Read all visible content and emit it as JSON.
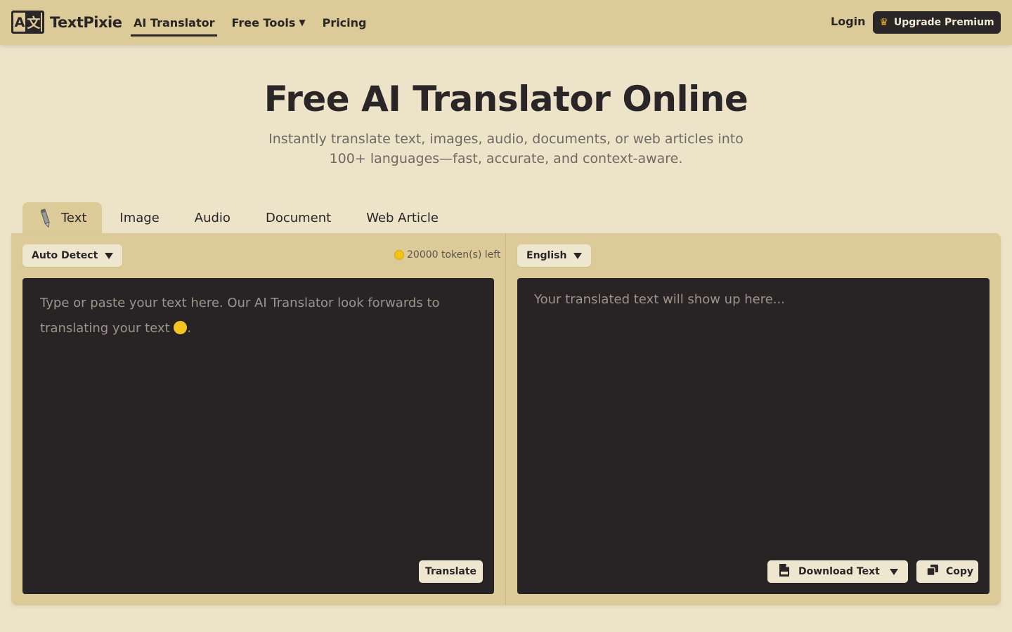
{
  "header": {
    "logo_mark": "A文",
    "logo_text": "TextPixie",
    "nav": [
      {
        "label": "AI Translator"
      },
      {
        "label": "Free Tools"
      },
      {
        "label": "Pricing"
      }
    ],
    "login": "Login",
    "upgrade": "Upgrade Premium"
  },
  "hero": {
    "title": "Free AI Translator Online",
    "subtitle": "Instantly translate text, images, audio, documents, or web articles into 100+ languages—fast, accurate, and context-aware."
  },
  "tabs": [
    {
      "label": "Text"
    },
    {
      "label": "Image"
    },
    {
      "label": "Audio"
    },
    {
      "label": "Document"
    },
    {
      "label": "Web Article"
    }
  ],
  "source": {
    "language": "Auto Detect",
    "tokens": "20000 token(s) left",
    "placeholder": "Type or paste your text here. Our AI Translator look forwards to translating your text",
    "placeholder_end": ".",
    "translate_button": "Translate"
  },
  "target": {
    "language": "English",
    "placeholder": "Your translated text will show up here...",
    "download_button": "Download Text",
    "copy_button": "Copy"
  },
  "colors": {
    "header_bg": "#dccb98",
    "page_bg": "#ede3c9",
    "dark": "#2a2526",
    "box_bg": "#282426"
  },
  "icons": {
    "crown": "crown-icon",
    "pen": "pen-icon",
    "coin": "coin-icon",
    "file": "txt-file-icon",
    "copy": "copy-icon"
  }
}
